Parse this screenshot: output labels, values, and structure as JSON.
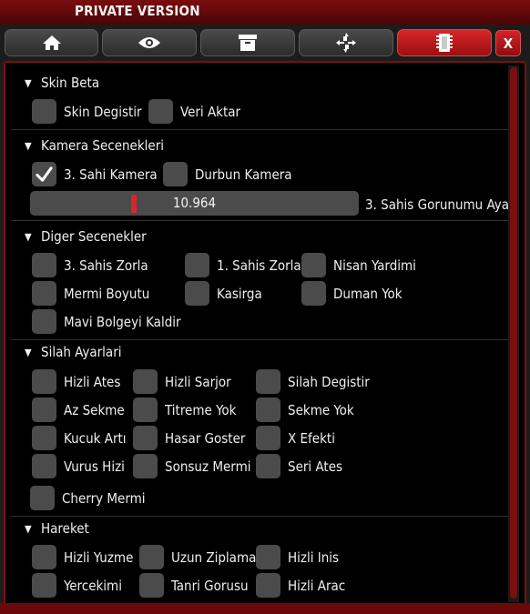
{
  "window": {
    "title": "PRIVATE VERSION",
    "close_label": "X"
  },
  "tabs": [
    {
      "icon": "home-icon",
      "active": false
    },
    {
      "icon": "eye-icon",
      "active": false
    },
    {
      "icon": "archive-icon",
      "active": false
    },
    {
      "icon": "crosshair-icon",
      "active": false
    },
    {
      "icon": "chip-icon",
      "active": true
    }
  ],
  "sections": {
    "skin": {
      "title": "Skin Beta",
      "options": [
        {
          "label": "Skin Degistir",
          "checked": false
        },
        {
          "label": "Veri Aktar",
          "checked": false
        }
      ]
    },
    "camera": {
      "title": "Kamera Secenekleri",
      "options": [
        {
          "label": "3. Sahi Kamera",
          "checked": true
        },
        {
          "label": "Durbun Kamera",
          "checked": false
        }
      ],
      "slider": {
        "value": "10.964",
        "label": "3. Sahis Gorunumu Aya",
        "fraction": 0.31
      }
    },
    "other": {
      "title": "Diger Secenekler",
      "options": [
        {
          "label": "3. Sahis Zorla",
          "checked": false
        },
        {
          "label": "1. Sahis Zorla",
          "checked": false
        },
        {
          "label": "Nisan Yardimi",
          "checked": false
        },
        {
          "label": "Mermi Boyutu",
          "checked": false
        },
        {
          "label": "Kasirga",
          "checked": false
        },
        {
          "label": "Duman Yok",
          "checked": false
        },
        {
          "label": "Mavi Bolgeyi Kaldir",
          "checked": false
        }
      ]
    },
    "weapon": {
      "title": "Silah Ayarlari",
      "options": [
        {
          "label": "Hizli Ates",
          "checked": false
        },
        {
          "label": "Hizli Sarjor",
          "checked": false
        },
        {
          "label": "Silah Degistir",
          "checked": false
        },
        {
          "label": "Az Sekme",
          "checked": false
        },
        {
          "label": "Titreme Yok",
          "checked": false
        },
        {
          "label": "Sekme Yok",
          "checked": false
        },
        {
          "label": "Kucuk Artı",
          "checked": false
        },
        {
          "label": "Hasar Goster",
          "checked": false
        },
        {
          "label": "X Efekti",
          "checked": false
        },
        {
          "label": "Vurus Hizi",
          "checked": false
        },
        {
          "label": "Sonsuz Mermi",
          "checked": false
        },
        {
          "label": "Seri Ates",
          "checked": false
        },
        {
          "label": "Cherry Mermi",
          "checked": false
        }
      ]
    },
    "movement": {
      "title": "Hareket",
      "options": [
        {
          "label": "Hizli Yuzme",
          "checked": false
        },
        {
          "label": "Uzun Ziplama",
          "checked": false
        },
        {
          "label": "Hizli Inis",
          "checked": false
        },
        {
          "label": "Yercekimi",
          "checked": false
        },
        {
          "label": "Tanri Gorusu",
          "checked": false
        },
        {
          "label": "Hizli Arac",
          "checked": false
        }
      ]
    }
  },
  "colors": {
    "accent": "#d9262a",
    "panel_border": "#7a0f12",
    "checkbox": "#4b4b4b",
    "background": "#000000"
  }
}
